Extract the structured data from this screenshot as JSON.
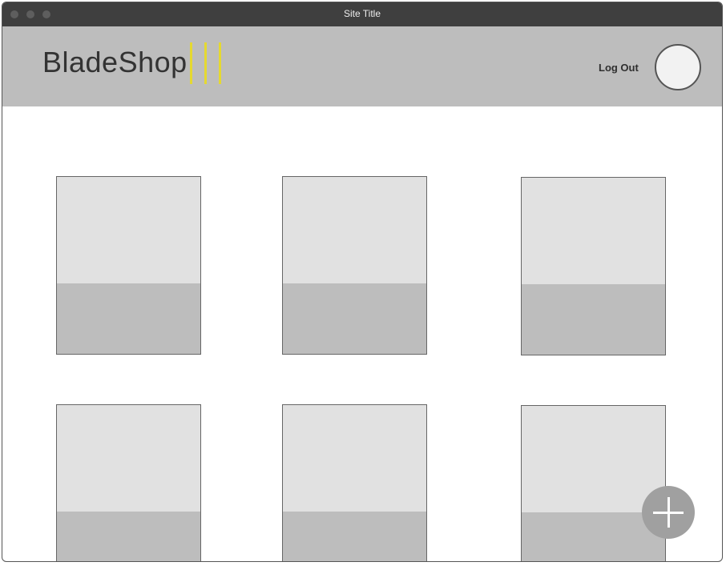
{
  "window": {
    "title": "Site Title"
  },
  "header": {
    "logo_text": "BladeShop",
    "menu_icon": "hamburger-menu-icon",
    "logout_label": "Log Out",
    "avatar_icon": "user-avatar-icon",
    "accent_color": "#e5d930",
    "background_color": "#bdbdbd"
  },
  "grid": {
    "products": [
      {
        "icon": "product-placeholder"
      },
      {
        "icon": "product-placeholder"
      },
      {
        "icon": "product-placeholder"
      },
      {
        "icon": "product-placeholder"
      },
      {
        "icon": "product-placeholder"
      },
      {
        "icon": "product-placeholder"
      }
    ]
  },
  "fab": {
    "icon": "plus-icon"
  }
}
